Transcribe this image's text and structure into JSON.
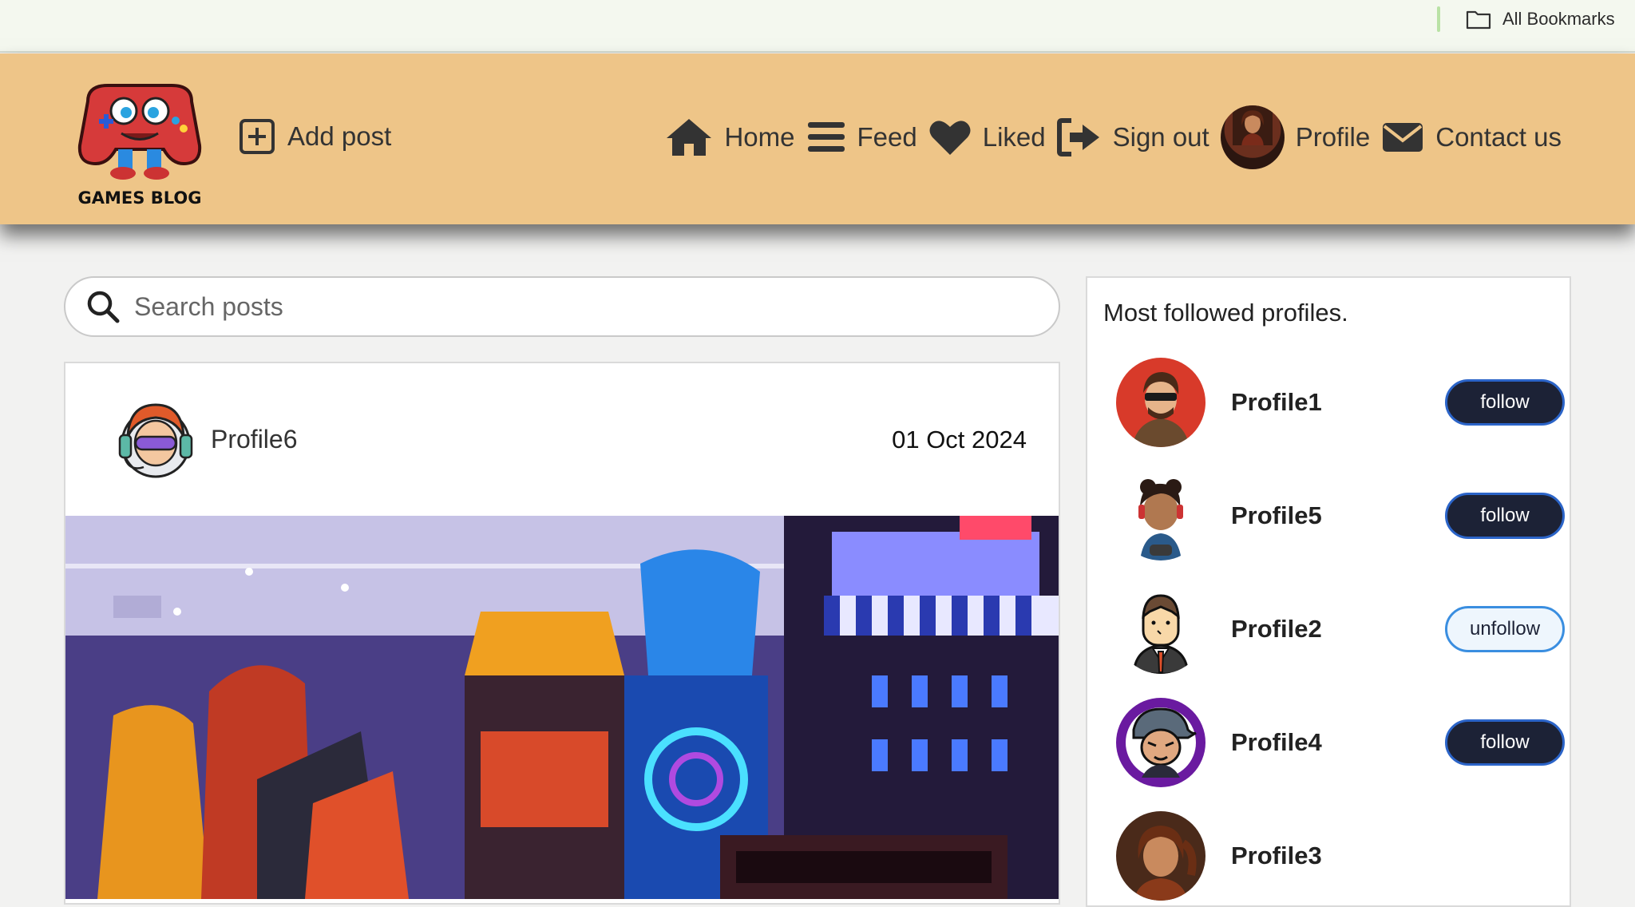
{
  "bookmarks": {
    "all_label": "All Bookmarks"
  },
  "header": {
    "logo_text": "GAMES BLOG",
    "add_post": "Add post",
    "nav": [
      {
        "label": "Home",
        "icon": "home-icon"
      },
      {
        "label": "Feed",
        "icon": "bars-icon"
      },
      {
        "label": "Liked",
        "icon": "heart-icon"
      },
      {
        "label": "Sign out",
        "icon": "sign-out-icon"
      },
      {
        "label": "Profile",
        "icon": "avatar"
      },
      {
        "label": "Contact us",
        "icon": "envelope-icon"
      }
    ]
  },
  "search": {
    "placeholder": "Search posts"
  },
  "post": {
    "author": "Profile6",
    "date": "01 Oct 2024"
  },
  "sidebar": {
    "title": "Most followed profiles.",
    "profiles": [
      {
        "name": "Profile1",
        "action": "follow"
      },
      {
        "name": "Profile5",
        "action": "follow"
      },
      {
        "name": "Profile2",
        "action": "unfollow"
      },
      {
        "name": "Profile4",
        "action": "follow"
      },
      {
        "name": "Profile3",
        "action": ""
      }
    ]
  },
  "colors": {
    "header_bg": "#eec588",
    "button_dark": "#1c2236",
    "button_border": "#2b64c8",
    "button_light": "#eef6fd"
  }
}
